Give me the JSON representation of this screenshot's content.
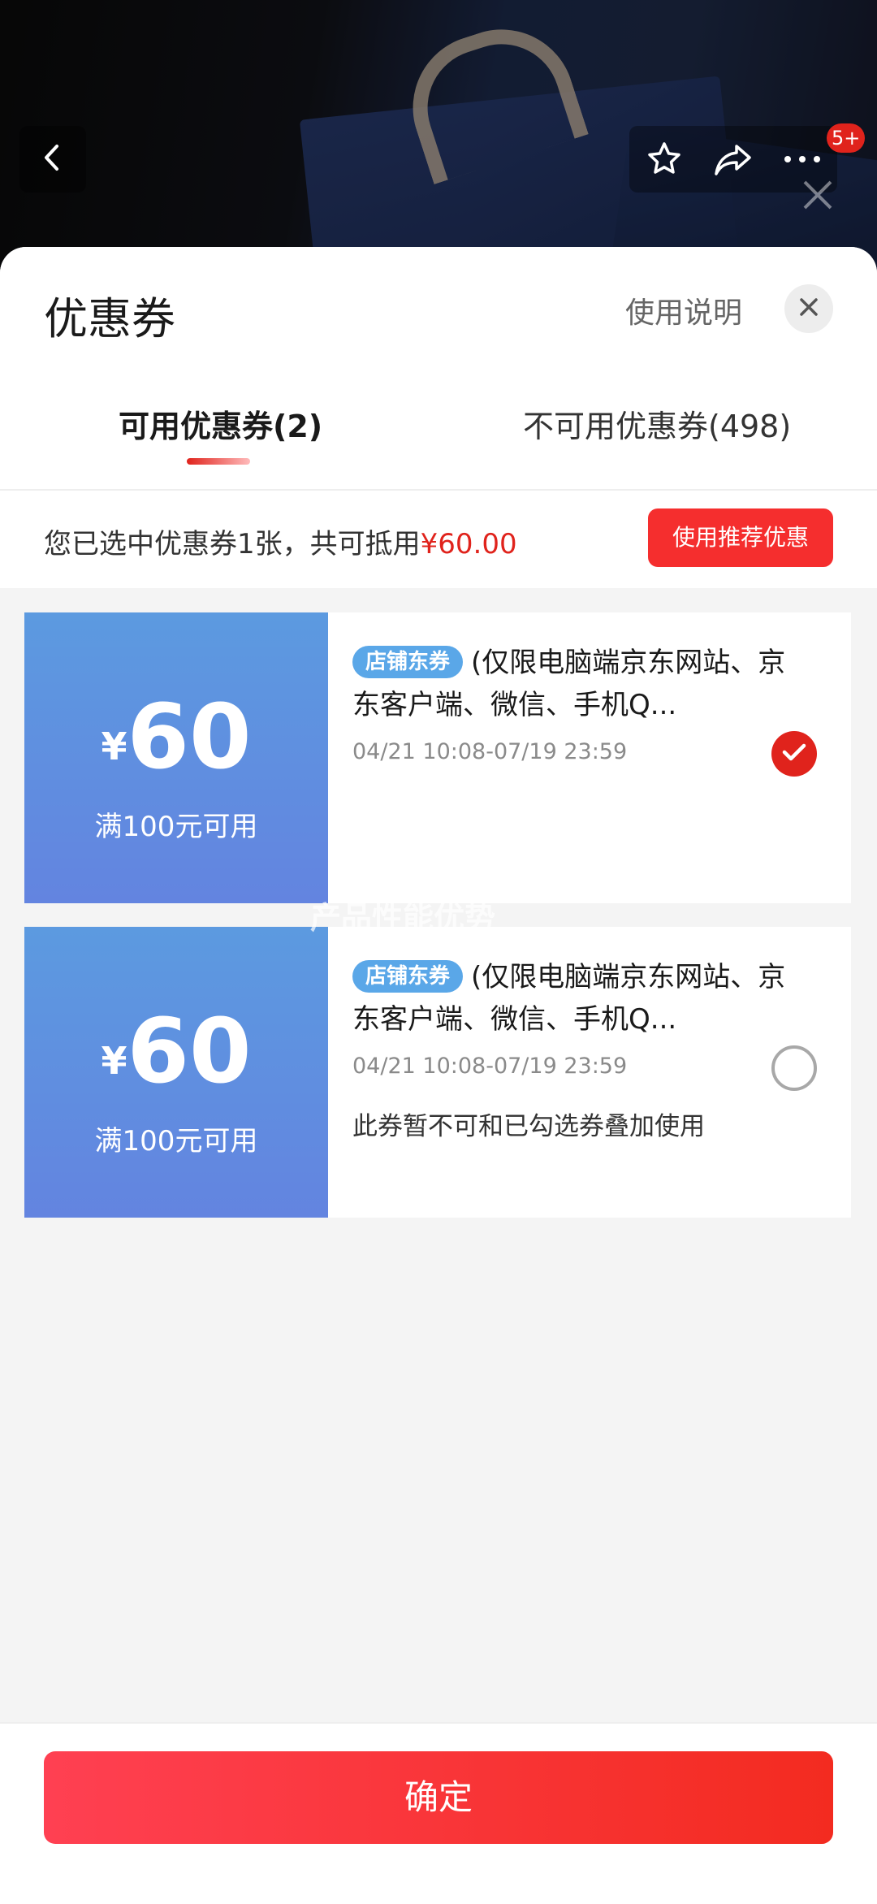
{
  "header": {
    "badge": "5+"
  },
  "sheet": {
    "title": "优惠券",
    "usage_link": "使用说明",
    "tabs": [
      {
        "label": "可用优惠券(2)",
        "active": true
      },
      {
        "label": "不可用优惠券(498)",
        "active": false
      }
    ],
    "summary": {
      "text": "您已选中优惠券1张，共可抵用",
      "amount": "¥60.00",
      "button": "使用推荐优惠"
    }
  },
  "coupons": [
    {
      "currency": "¥",
      "amount": "60",
      "condition": "满100元可用",
      "tag": "店铺东券",
      "title": "(仅限电脑端京东网站、京东客户端、微信、手机Q...",
      "valid_period": "04/21 10:08-07/19 23:59",
      "selected": true,
      "note": ""
    },
    {
      "currency": "¥",
      "amount": "60",
      "condition": "满100元可用",
      "tag": "店铺东券",
      "title": "(仅限电脑端京东网站、京东客户端、微信、手机Q...",
      "valid_period": "04/21 10:08-07/19 23:59",
      "selected": false,
      "note": "此券暂不可和已勾选券叠加使用"
    }
  ],
  "watermark": "产品性能优势",
  "footer": {
    "confirm_label": "确定"
  },
  "colors": {
    "accent_red": "#e0231c",
    "coupon_blue": "#5c9ae0",
    "tag_blue": "#5aa7e8"
  },
  "icons": [
    "back-icon",
    "star-icon",
    "share-icon",
    "more-icon",
    "close-icon",
    "check-icon"
  ]
}
